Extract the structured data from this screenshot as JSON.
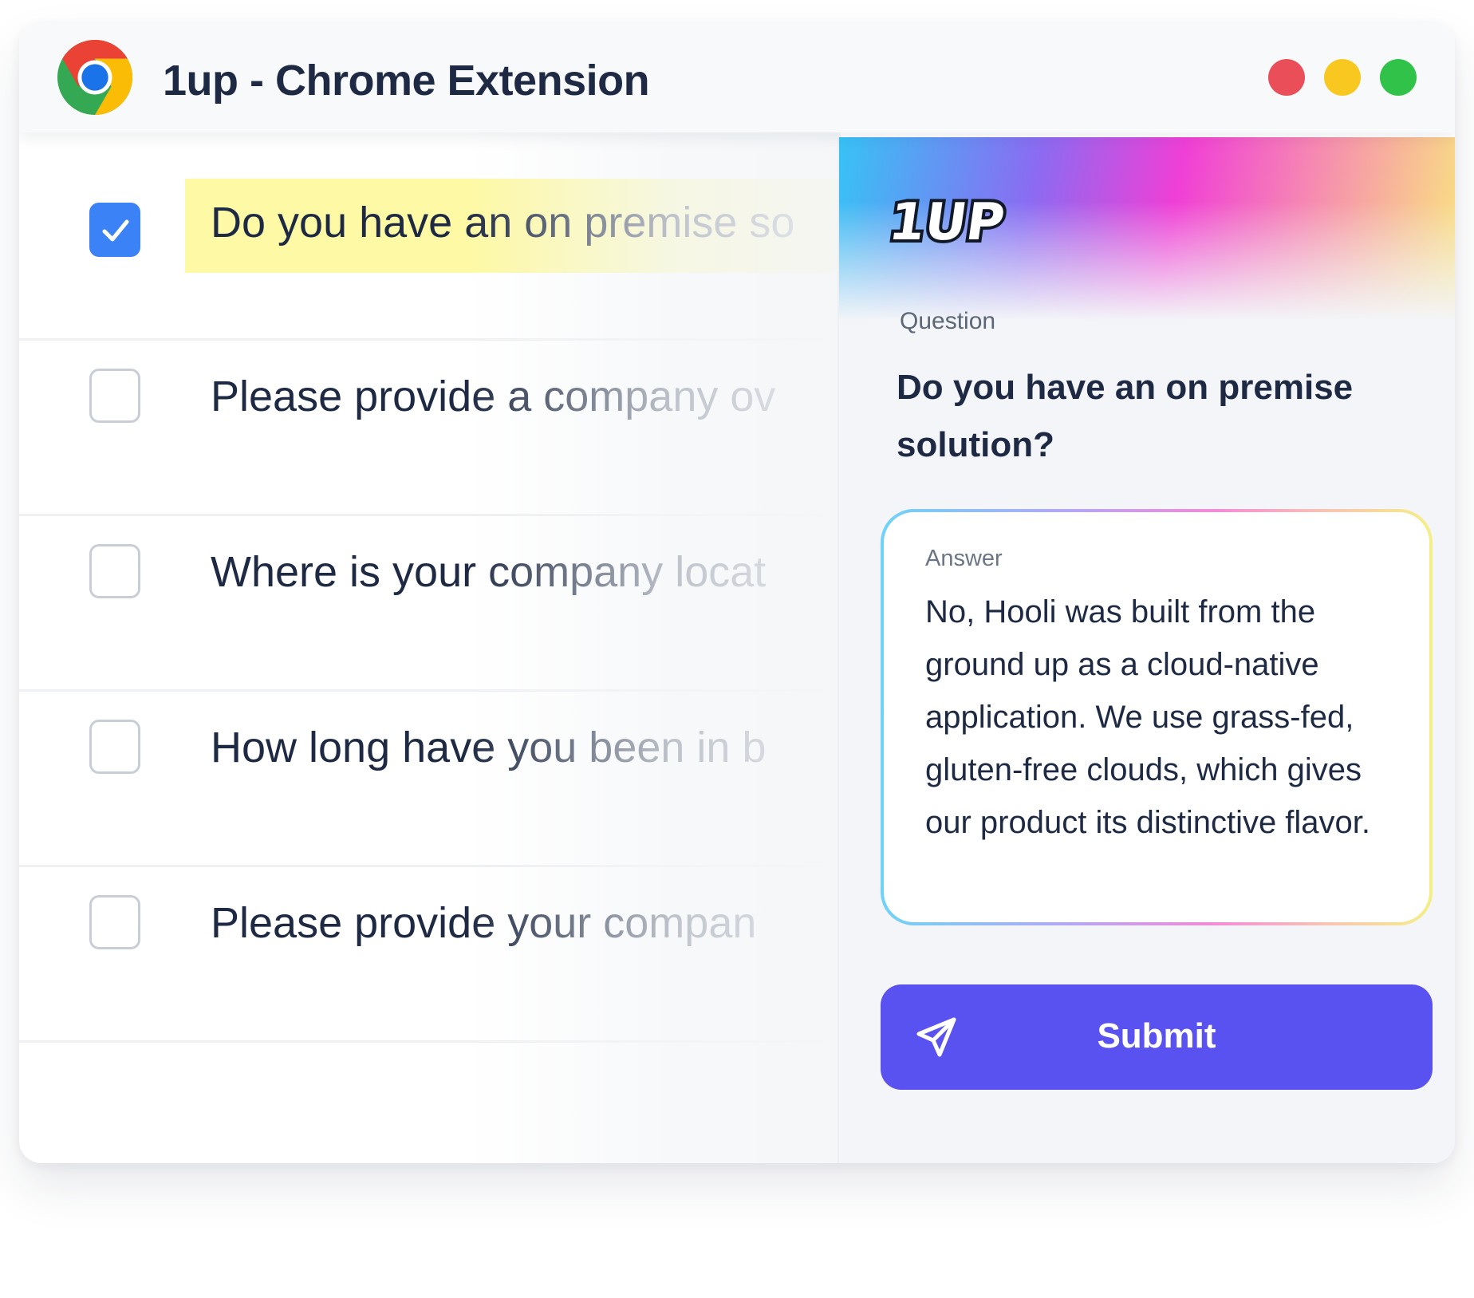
{
  "titlebar": {
    "title": "1up - Chrome Extension",
    "logo_icon": "chrome-icon",
    "traffic_lights": [
      "#ea4f59",
      "#f8c720",
      "#31c24a"
    ]
  },
  "list": {
    "items": [
      {
        "text": "Do you have an on premise so",
        "checked": true,
        "highlighted": true
      },
      {
        "text": "Please provide a company ov",
        "checked": false
      },
      {
        "text": "Where is your company locat",
        "checked": false
      },
      {
        "text": "How long have you been in b",
        "checked": false
      },
      {
        "text": "Please provide your compan",
        "checked": false
      }
    ]
  },
  "panel": {
    "logo_text": "1UP",
    "question_label": "Question",
    "question_text": "Do you have an on premise solution?",
    "answer_label": "Answer",
    "answer_text": "No, Hooli was built from the ground up as a cloud-native application. We use grass-fed, gluten-free clouds, which gives our product its distinctive flavor.",
    "submit_label": "Submit",
    "submit_icon": "send-icon",
    "accent_color": "#5a52f0"
  }
}
